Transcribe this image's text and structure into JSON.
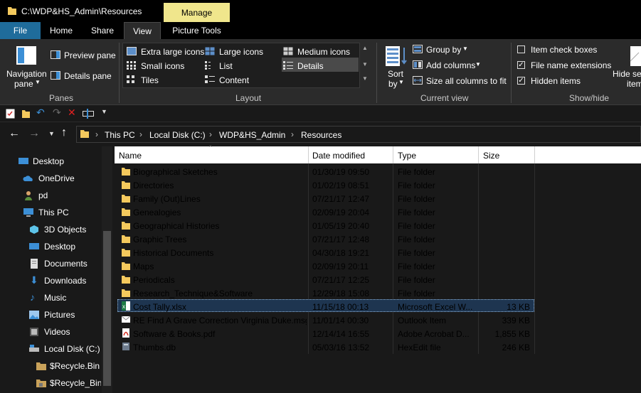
{
  "window": {
    "title": "C:\\WDP&HS_Admin\\Resources",
    "manage_label": "Manage"
  },
  "tabs": {
    "file": "File",
    "home": "Home",
    "share": "Share",
    "view": "View",
    "picture_tools": "Picture Tools"
  },
  "ribbon": {
    "panes": {
      "navigation_pane": "Navigation",
      "navigation_pane_2": "pane",
      "preview_pane": "Preview pane",
      "details_pane": "Details pane",
      "group_label": "Panes"
    },
    "layout": {
      "extra_large_icons": "Extra large icons",
      "large_icons": "Large icons",
      "medium_icons": "Medium icons",
      "small_icons": "Small icons",
      "list": "List",
      "details": "Details",
      "tiles": "Tiles",
      "content": "Content",
      "group_label": "Layout"
    },
    "current_view": {
      "sort_by": "Sort",
      "sort_by_2": "by",
      "group_by": "Group by",
      "add_columns": "Add columns",
      "size_all_columns": "Size all columns to fit",
      "group_label": "Current view"
    },
    "show_hide": {
      "item_check_boxes": "Item check boxes",
      "item_check_boxes_checked": false,
      "file_name_extensions": "File name extensions",
      "file_name_extensions_checked": true,
      "hidden_items": "Hidden items",
      "hidden_items_checked": true,
      "hide_selected": "Hide sel",
      "hide_selected_2": "item",
      "group_label": "Show/hide"
    }
  },
  "address": {
    "crumbs": [
      "This PC",
      "Local Disk (C:)",
      "WDP&HS_Admin",
      "Resources"
    ]
  },
  "nav": {
    "items": [
      {
        "label": "Desktop",
        "icon": "desktop-icon"
      },
      {
        "label": "OneDrive",
        "icon": "cloud-icon"
      },
      {
        "label": "pd",
        "icon": "user-icon"
      },
      {
        "label": "This PC",
        "icon": "computer-icon"
      },
      {
        "label": "3D Objects",
        "icon": "cube-icon"
      },
      {
        "label": "Desktop",
        "icon": "desktop-icon"
      },
      {
        "label": "Documents",
        "icon": "documents-icon"
      },
      {
        "label": "Downloads",
        "icon": "download-icon"
      },
      {
        "label": "Music",
        "icon": "music-icon"
      },
      {
        "label": "Pictures",
        "icon": "pictures-icon"
      },
      {
        "label": "Videos",
        "icon": "videos-icon"
      },
      {
        "label": "Local Disk (C:)",
        "icon": "drive-icon"
      },
      {
        "label": "$Recycle.Bin",
        "icon": "folder-icon"
      },
      {
        "label": "$Recycle_Bin_",
        "icon": "lock-folder-icon"
      }
    ]
  },
  "columns": {
    "name": "Name",
    "date_modified": "Date modified",
    "type": "Type",
    "size": "Size"
  },
  "files": [
    {
      "name": "Biographical Sketches",
      "date": "01/30/19 09:50",
      "type": "File folder",
      "size": "",
      "icon": "folder-icon"
    },
    {
      "name": "Directories",
      "date": "01/02/19 08:51",
      "type": "File folder",
      "size": "",
      "icon": "folder-icon"
    },
    {
      "name": "Family (Out)Lines",
      "date": "07/21/17 12:47",
      "type": "File folder",
      "size": "",
      "icon": "folder-icon"
    },
    {
      "name": "Genealogies",
      "date": "02/09/19 20:04",
      "type": "File folder",
      "size": "",
      "icon": "folder-icon"
    },
    {
      "name": "Geographical Histories",
      "date": "01/05/19 20:40",
      "type": "File folder",
      "size": "",
      "icon": "folder-icon"
    },
    {
      "name": "Graphic Trees",
      "date": "07/21/17 12:48",
      "type": "File folder",
      "size": "",
      "icon": "folder-icon"
    },
    {
      "name": "Historical Documents",
      "date": "04/30/18 19:21",
      "type": "File folder",
      "size": "",
      "icon": "folder-icon"
    },
    {
      "name": "Maps",
      "date": "02/09/19 20:11",
      "type": "File folder",
      "size": "",
      "icon": "folder-icon"
    },
    {
      "name": "Periodicals",
      "date": "07/21/17 12:25",
      "type": "File folder",
      "size": "",
      "icon": "folder-icon"
    },
    {
      "name": "Research_Technique&Software",
      "date": "12/29/18 15:08",
      "type": "File folder",
      "size": "",
      "icon": "folder-icon"
    },
    {
      "name": "Cost Tally.xlsx",
      "date": "11/15/18 00:13",
      "type": "Microsoft Excel W...",
      "size": "13 KB",
      "icon": "excel-icon"
    },
    {
      "name": "RE Find A Grave Correction Virginia Duke.msg",
      "date": "11/01/14 00:30",
      "type": "Outlook Item",
      "size": "339 KB",
      "icon": "mail-icon"
    },
    {
      "name": "Software & Books.pdf",
      "date": "12/14/14 16:55",
      "type": "Adobe Acrobat D...",
      "size": "1,855 KB",
      "icon": "pdf-icon"
    },
    {
      "name": "Thumbs.db",
      "date": "05/03/16 13:52",
      "type": "HexEdit file",
      "size": "246 KB",
      "icon": "db-icon"
    }
  ],
  "colors": {
    "file_tab": "#1f6c9b",
    "manage_tab": "#f0e68c",
    "folder_yellow": "#f4c95d",
    "selection": "#1e3550"
  }
}
